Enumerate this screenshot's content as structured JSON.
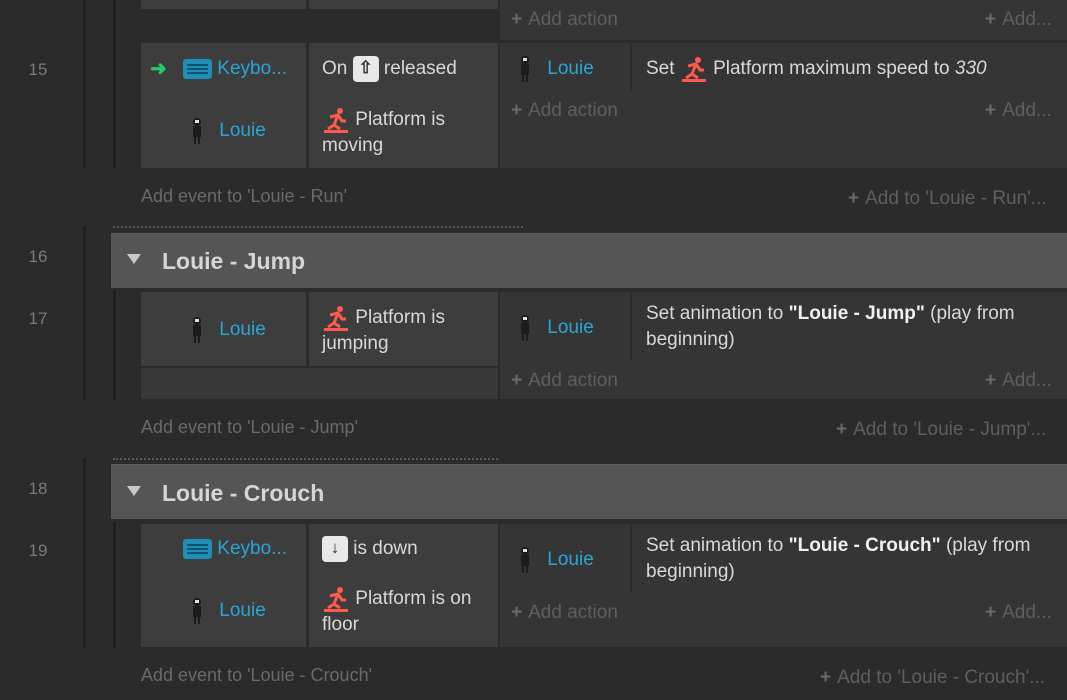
{
  "colors": {
    "background": "#2b2b2b",
    "object_link": "#2aa6d6",
    "group_bar": "#555555",
    "trigger_arrow": "#27c76a",
    "platform_icon": "#ff5a4e",
    "keyboard_icon": "#1f8fb8"
  },
  "top_partial": {
    "add_action": "Add action",
    "add_right": "Add..."
  },
  "event15": {
    "line": "15",
    "cond1_object": "Keybo...",
    "cond1_pre": "On",
    "cond1_key": "⇧",
    "cond1_post": "released",
    "cond2_object": "Louie",
    "cond2_text": "Platform is moving",
    "act1_object": "Louie",
    "act1_pre": "Set",
    "act1_text": "Platform maximum speed to",
    "act1_value": "330",
    "add_action": "Add action",
    "add_right": "Add..."
  },
  "run_footer": {
    "add_event": "Add event to 'Louie - Run'",
    "add_to": "Add to 'Louie - Run'..."
  },
  "group16": {
    "line": "16",
    "title": "Louie - Jump"
  },
  "event17": {
    "line": "17",
    "cond1_object": "Louie",
    "cond1_text": "Platform is jumping",
    "act1_object": "Louie",
    "act1_pre": "Set animation to",
    "act1_value": "\"Louie - Jump\"",
    "act1_post": "(play from beginning)",
    "add_action": "Add action",
    "add_right": "Add..."
  },
  "jump_footer": {
    "add_event": "Add event to 'Louie - Jump'",
    "add_to": "Add to 'Louie - Jump'..."
  },
  "group18": {
    "line": "18",
    "title": "Louie - Crouch"
  },
  "event19": {
    "line": "19",
    "cond1_object": "Keybo...",
    "cond1_key": "↓",
    "cond1_post": "is down",
    "cond2_object": "Louie",
    "cond2_text": "Platform is on floor",
    "act1_object": "Louie",
    "act1_pre": "Set animation to",
    "act1_value": "\"Louie - Crouch\"",
    "act1_post": "(play from beginning)",
    "add_action": "Add action",
    "add_right": "Add..."
  },
  "crouch_footer": {
    "add_event": "Add event to 'Louie - Crouch'",
    "add_to": "Add to 'Louie - Crouch'..."
  }
}
